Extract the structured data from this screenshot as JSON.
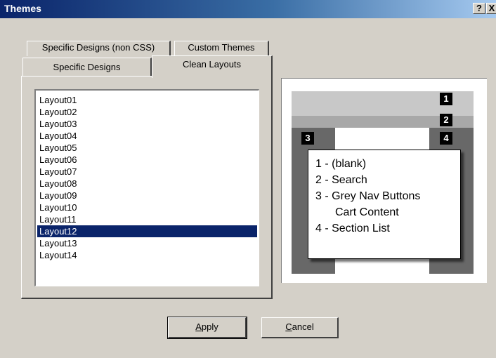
{
  "window": {
    "title": "Themes",
    "help_label": "?",
    "close_label": "X"
  },
  "tabs": [
    {
      "label": "Specific Designs (non CSS)"
    },
    {
      "label": "Custom Themes"
    },
    {
      "label": "Specific Designs"
    },
    {
      "label": "Clean Layouts",
      "active": true
    }
  ],
  "layouts": {
    "items": [
      "Layout01",
      "Layout02",
      "Layout03",
      "Layout04",
      "Layout05",
      "Layout06",
      "Layout07",
      "Layout08",
      "Layout09",
      "Layout10",
      "Layout11",
      "Layout12",
      "Layout13",
      "Layout14"
    ],
    "selected": "Layout12"
  },
  "preview": {
    "badges": [
      "1",
      "2",
      "3",
      "4"
    ],
    "legend": [
      "1 - (blank)",
      "2 - Search",
      "3 - Grey Nav Buttons",
      "Cart Content",
      "4 - Section List"
    ],
    "colors": {
      "top": "#c8c8c8",
      "search": "#a8a8a8",
      "sides": "#686868"
    }
  },
  "buttons": {
    "apply": {
      "mnemonic": "A",
      "rest": "pply"
    },
    "cancel": {
      "mnemonic": "C",
      "rest": "ancel"
    }
  }
}
